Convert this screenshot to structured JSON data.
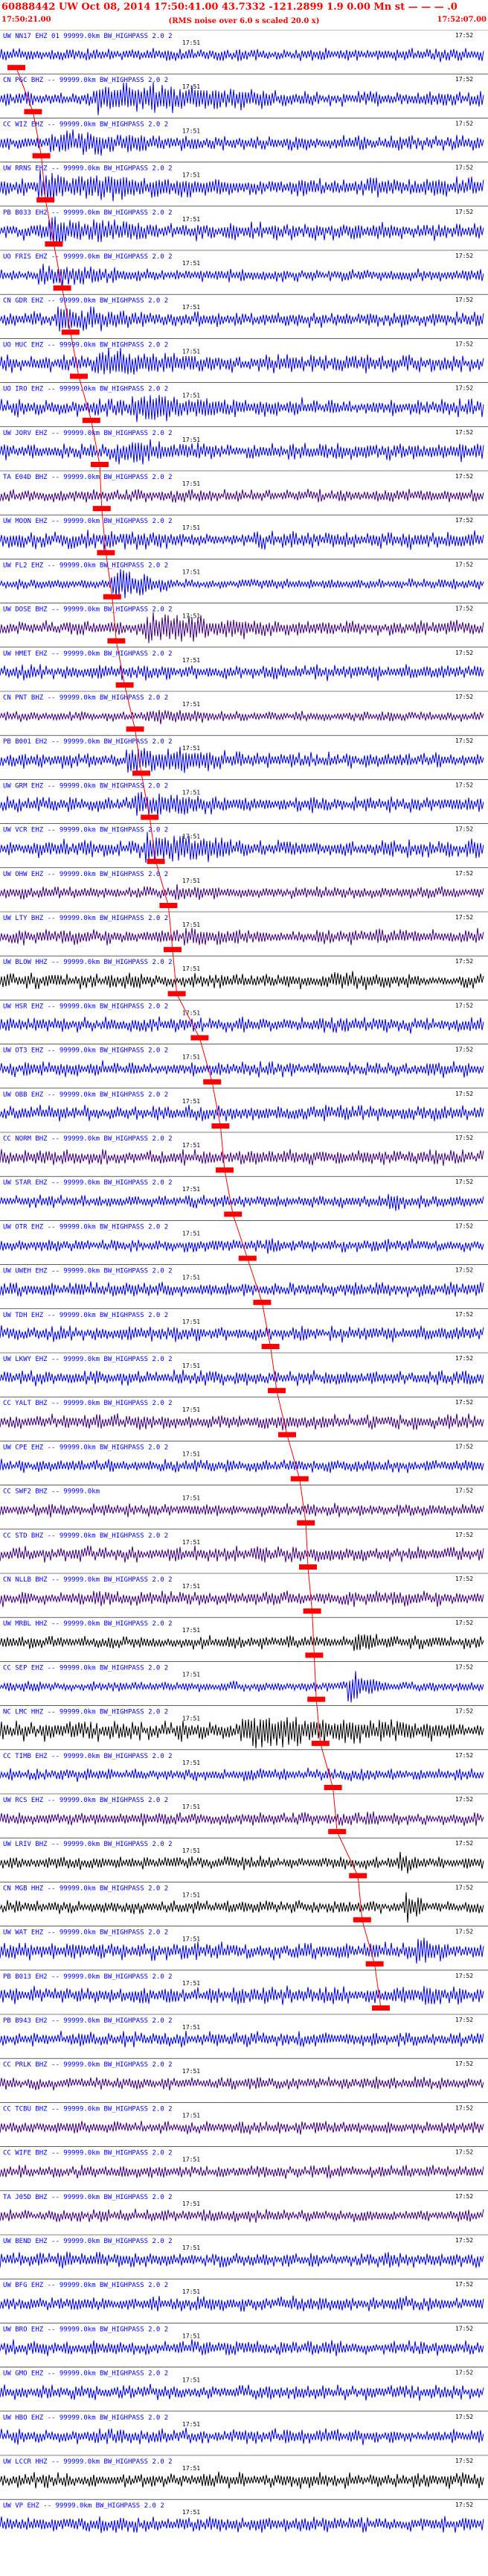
{
  "header": {
    "title": "60888442 UW Oct 08, 2014 17:50:41.00    43.7332  -121.2899   1.9 0.00  Mn st — —  — .0",
    "time_start": "17:50:21.00",
    "subtitle": "(RMS noise over 6.0 s scaled 20.0 x)",
    "time_end": "17:52:07.00"
  },
  "time_ticks": [
    "17:51",
    "17:52"
  ],
  "colors": {
    "header_text": "#ff0000",
    "pick_marker": "#ff0000",
    "travel_time_line": "#ff0000",
    "label": "#0000ff",
    "separator": "#000000",
    "trace_blue": "#0000ff",
    "trace_purple": "#400080",
    "trace_black": "#000000"
  },
  "channels": [
    {
      "label": "UW NN17 EHZ 01 99999.0km BW_HIGHPASS  2.0  2",
      "color": "#0000ff",
      "amp": 10,
      "pick": 0.0,
      "event": null
    },
    {
      "label": "CN PGC BHZ -- 99999.0km BW_HIGHPASS  2.0  2",
      "color": "#0000ff",
      "amp": 12,
      "pick": 0.04,
      "event": {
        "start": 0.19,
        "end": 0.65,
        "amp": 28
      }
    },
    {
      "label": "CC WIZ EHZ -- 99999.0km BW_HIGHPASS  2.0  2",
      "color": "#0000ff",
      "amp": 12,
      "pick": 0.06,
      "event": {
        "start": 0.1,
        "end": 0.45,
        "amp": 22
      }
    },
    {
      "label": "UW RRNS EHZ -- 99999.0km BW_HIGHPASS  2.0  2",
      "color": "#0000ff",
      "amp": 16,
      "pick": 0.07,
      "event": {
        "start": 0.08,
        "end": 0.6,
        "amp": 24
      }
    },
    {
      "label": "PB B033 EH2 -- 99999.0km BW_HIGHPASS  2.0  2",
      "color": "#0000ff",
      "amp": 14,
      "pick": 0.09,
      "event": {
        "start": 0.09,
        "end": 0.4,
        "amp": 24
      }
    },
    {
      "label": "UO FRIS EHZ -- 99999.0km BW_HIGHPASS  2.0  2",
      "color": "#0000ff",
      "amp": 10,
      "pick": 0.11,
      "event": {
        "start": 0.08,
        "end": 0.3,
        "amp": 20
      }
    },
    {
      "label": "CN GDR EHZ -- 99999.0km BW_HIGHPASS  2.0  2",
      "color": "#0000ff",
      "amp": 12,
      "pick": 0.13,
      "event": {
        "start": 0.12,
        "end": 0.4,
        "amp": 22
      }
    },
    {
      "label": "UO HUC EHZ -- 99999.0km BW_HIGHPASS  2.0  2",
      "color": "#0000ff",
      "amp": 14,
      "pick": 0.15,
      "event": {
        "start": 0.2,
        "end": 0.45,
        "amp": 28
      }
    },
    {
      "label": "UO IRO EHZ -- 99999.0km BW_HIGHPASS  2.0  2",
      "color": "#0000ff",
      "amp": 14,
      "pick": 0.18,
      "event": {
        "start": 0.27,
        "end": 0.52,
        "amp": 28
      }
    },
    {
      "label": "UW JORV EHZ -- 99999.0km BW_HIGHPASS  2.0  2",
      "color": "#0000ff",
      "amp": 14,
      "pick": 0.2,
      "event": {
        "start": 0.24,
        "end": 0.5,
        "amp": 22
      }
    },
    {
      "label": "TA E04D BHZ -- 99999.0km BW_HIGHPASS  2.0  2",
      "color": "#400080",
      "amp": 10,
      "pick": 0.205,
      "event": null
    },
    {
      "label": "UW MOON EHZ -- 99999.0km BW_HIGHPASS  2.0  2",
      "color": "#0000ff",
      "amp": 14,
      "pick": 0.215,
      "event": {
        "start": 0.22,
        "end": 0.5,
        "amp": 18
      }
    },
    {
      "label": "UW FL2 EHZ -- 99999.0km BW_HIGHPASS  2.0  2",
      "color": "#0000ff",
      "amp": 8,
      "pick": 0.23,
      "event": {
        "start": 0.23,
        "end": 0.35,
        "amp": 28
      }
    },
    {
      "label": "UW DOSE BHZ -- 99999.0km BW_HIGHPASS  2.0  2",
      "color": "#400080",
      "amp": 12,
      "pick": 0.24,
      "event": {
        "start": 0.3,
        "end": 0.7,
        "amp": 24
      }
    },
    {
      "label": "UW HMET EHZ -- 99999.0km BW_HIGHPASS  2.0  2",
      "color": "#0000ff",
      "amp": 12,
      "pick": 0.26,
      "event": null
    },
    {
      "label": "CN PNT BHZ -- 99999.0km BW_HIGHPASS  2.0  2",
      "color": "#400080",
      "amp": 8,
      "pick": 0.285,
      "event": {
        "start": 0.3,
        "end": 0.55,
        "amp": 14
      }
    },
    {
      "label": "PB B001 EH2 -- 99999.0km BW_HIGHPASS  2.0  2",
      "color": "#0000ff",
      "amp": 12,
      "pick": 0.3,
      "event": {
        "start": 0.26,
        "end": 0.6,
        "amp": 24
      }
    },
    {
      "label": "UW GRM EHZ -- 99999.0km BW_HIGHPASS  2.0  2",
      "color": "#0000ff",
      "amp": 12,
      "pick": 0.32,
      "event": {
        "start": 0.28,
        "end": 0.55,
        "amp": 22
      }
    },
    {
      "label": "UW VCR EHZ -- 99999.0km BW_HIGHPASS  2.0  2",
      "color": "#0000ff",
      "amp": 14,
      "pick": 0.335,
      "event": {
        "start": 0.3,
        "end": 0.55,
        "amp": 28
      }
    },
    {
      "label": "UW OHW EHZ -- 99999.0km BW_HIGHPASS  2.0  2",
      "color": "#400080",
      "amp": 10,
      "pick": 0.365,
      "event": {
        "start": 0.36,
        "end": 0.6,
        "amp": 14
      }
    },
    {
      "label": "UW LTY BHZ -- 99999.0km BW_HIGHPASS  2.0  2",
      "color": "#400080",
      "amp": 12,
      "pick": 0.375,
      "event": {
        "start": 0.38,
        "end": 0.65,
        "amp": 16
      }
    },
    {
      "label": "UW BLOW HHZ -- 99999.0km BW_HIGHPASS  2.0  2",
      "color": "#000000",
      "amp": 12,
      "pick": 0.385,
      "event": {
        "start": 0.7,
        "end": 0.95,
        "amp": 16
      }
    },
    {
      "label": "UW HSR EHZ -- 99999.0km BW_HIGHPASS  2.0  2",
      "color": "#0000ff",
      "amp": 12,
      "pick": 0.44,
      "event": null
    },
    {
      "label": "UW OT3 EHZ -- 99999.0km BW_HIGHPASS  2.0  2",
      "color": "#0000ff",
      "amp": 12,
      "pick": 0.47,
      "event": null
    },
    {
      "label": "UW OBB EHZ -- 99999.0km BW_HIGHPASS  2.0  2",
      "color": "#0000ff",
      "amp": 12,
      "pick": 0.49,
      "event": null
    },
    {
      "label": "CC NORM BHZ -- 99999.0km BW_HIGHPASS  2.0  2",
      "color": "#400080",
      "amp": 12,
      "pick": 0.5,
      "event": null
    },
    {
      "label": "UW STAR EHZ -- 99999.0km BW_HIGHPASS  2.0  2",
      "color": "#0000ff",
      "amp": 10,
      "pick": 0.52,
      "event": {
        "start": 0.8,
        "end": 0.86,
        "amp": 18
      }
    },
    {
      "label": "UW OTR EHZ -- 99999.0km BW_HIGHPASS  2.0  2",
      "color": "#0000ff",
      "amp": 10,
      "pick": 0.555,
      "event": {
        "start": 0.55,
        "end": 0.6,
        "amp": 16
      }
    },
    {
      "label": "UW UWEH EHZ -- 99999.0km BW_HIGHPASS  2.0  2",
      "color": "#0000ff",
      "amp": 12,
      "pick": 0.59,
      "event": null
    },
    {
      "label": "UW TDH EHZ -- 99999.0km BW_HIGHPASS  2.0  2",
      "color": "#0000ff",
      "amp": 12,
      "pick": 0.61,
      "event": {
        "start": 0.62,
        "end": 0.68,
        "amp": 14
      }
    },
    {
      "label": "UW LKWY EHZ -- 99999.0km BW_HIGHPASS  2.0  2",
      "color": "#0000ff",
      "amp": 12,
      "pick": 0.625,
      "event": null
    },
    {
      "label": "CC YALT BHZ -- 99999.0km BW_HIGHPASS  2.0  2",
      "color": "#400080",
      "amp": 12,
      "pick": 0.65,
      "event": null
    },
    {
      "label": "UW CPE EHZ -- 99999.0km BW_HIGHPASS  2.0  2",
      "color": "#0000ff",
      "amp": 10,
      "pick": 0.68,
      "event": null
    },
    {
      "label": "CC SWF2 BHZ -- 99999.0km",
      "color": "#400080",
      "amp": 10,
      "pick": 0.695,
      "event": {
        "start": 0.69,
        "end": 0.74,
        "amp": 14
      }
    },
    {
      "label": "CC STD BHZ -- 99999.0km BW_HIGHPASS  2.0  2",
      "color": "#400080",
      "amp": 12,
      "pick": 0.7,
      "event": null
    },
    {
      "label": "CN NLLB BHZ -- 99999.0km BW_HIGHPASS  2.0  2",
      "color": "#400080",
      "amp": 12,
      "pick": 0.71,
      "event": null
    },
    {
      "label": "UW MRBL HHZ -- 99999.0km BW_HIGHPASS  2.0  2",
      "color": "#000000",
      "amp": 10,
      "pick": 0.715,
      "event": {
        "start": 0.73,
        "end": 0.78,
        "amp": 28
      }
    },
    {
      "label": "CC SEP EHZ -- 99999.0km BW_HIGHPASS  2.0  2",
      "color": "#0000ff",
      "amp": 8,
      "pick": 0.72,
      "event": {
        "start": 0.72,
        "end": 0.8,
        "amp": 28
      }
    },
    {
      "label": "NC LMC HHZ -- 99999.0km BW_HIGHPASS  2.0  2",
      "color": "#000000",
      "amp": 16,
      "pick": 0.73,
      "event": {
        "start": 0.5,
        "end": 1.0,
        "amp": 28
      }
    },
    {
      "label": "CC TIMB EHZ -- 99999.0km BW_HIGHPASS  2.0  2",
      "color": "#0000ff",
      "amp": 10,
      "pick": 0.76,
      "event": null
    },
    {
      "label": "UW RCS EHZ -- 99999.0km BW_HIGHPASS  2.0  2",
      "color": "#400080",
      "amp": 10,
      "pick": 0.77,
      "event": {
        "start": 0.76,
        "end": 0.8,
        "amp": 16
      }
    },
    {
      "label": "UW LRIV BHZ -- 99999.0km BW_HIGHPASS  2.0  2",
      "color": "#000000",
      "amp": 10,
      "pick": 0.82,
      "event": {
        "start": 0.82,
        "end": 0.88,
        "amp": 22
      }
    },
    {
      "label": "CN MGB HHZ -- 99999.0km BW_HIGHPASS  2.0  2",
      "color": "#000000",
      "amp": 10,
      "pick": 0.83,
      "event": {
        "start": 0.84,
        "end": 0.88,
        "amp": 28
      }
    },
    {
      "label": "UW WAT EHZ -- 99999.0km BW_HIGHPASS  2.0  2",
      "color": "#0000ff",
      "amp": 14,
      "pick": 0.86,
      "event": {
        "start": 0.86,
        "end": 0.95,
        "amp": 26
      }
    },
    {
      "label": "PB B013 EH2 -- 99999.0km BW_HIGHPASS  2.0  2",
      "color": "#0000ff",
      "amp": 14,
      "pick": 0.875,
      "event": {
        "start": 0.88,
        "end": 0.92,
        "amp": 24
      }
    },
    {
      "label": "PB B943 EH2 -- 99999.0km BW_HIGHPASS  2.0  2",
      "color": "#0000ff",
      "amp": 12,
      "pick": null,
      "event": null
    },
    {
      "label": "CC PRLK BHZ -- 99999.0km BW_HIGHPASS  2.0  2",
      "color": "#400080",
      "amp": 10,
      "pick": null,
      "event": null
    },
    {
      "label": "CC TCBU BHZ -- 99999.0km BW_HIGHPASS  2.0  2",
      "color": "#400080",
      "amp": 10,
      "pick": null,
      "event": null
    },
    {
      "label": "CC WIFE BHZ -- 99999.0km BW_HIGHPASS  2.0  2",
      "color": "#400080",
      "amp": 10,
      "pick": null,
      "event": null
    },
    {
      "label": "TA J05D BHZ -- 99999.0km BW_HIGHPASS  2.0  2",
      "color": "#400080",
      "amp": 10,
      "pick": null,
      "event": null
    },
    {
      "label": "UW BEND EHZ -- 99999.0km BW_HIGHPASS  2.0  2",
      "color": "#0000ff",
      "amp": 12,
      "pick": null,
      "event": null
    },
    {
      "label": "UW BFG EHZ -- 99999.0km BW_HIGHPASS  2.0  2",
      "color": "#0000ff",
      "amp": 12,
      "pick": null,
      "event": null
    },
    {
      "label": "UW BRO EHZ -- 99999.0km BW_HIGHPASS  2.0  2",
      "color": "#0000ff",
      "amp": 12,
      "pick": null,
      "event": null
    },
    {
      "label": "UW GMO EHZ -- 99999.0km BW_HIGHPASS  2.0  2",
      "color": "#0000ff",
      "amp": 12,
      "pick": null,
      "event": null
    },
    {
      "label": "UW HBO EHZ -- 99999.0km BW_HIGHPASS  2.0  2",
      "color": "#0000ff",
      "amp": 12,
      "pick": null,
      "event": null
    },
    {
      "label": "UW LCCR HHZ -- 99999.0km BW_HIGHPASS  2.0  2",
      "color": "#000000",
      "amp": 12,
      "pick": null,
      "event": null
    },
    {
      "label": "UW VP EHZ -- 99999.0km BW_HIGHPASS  2.0  2",
      "color": "#0000ff",
      "amp": 12,
      "pick": null,
      "event": null
    }
  ]
}
